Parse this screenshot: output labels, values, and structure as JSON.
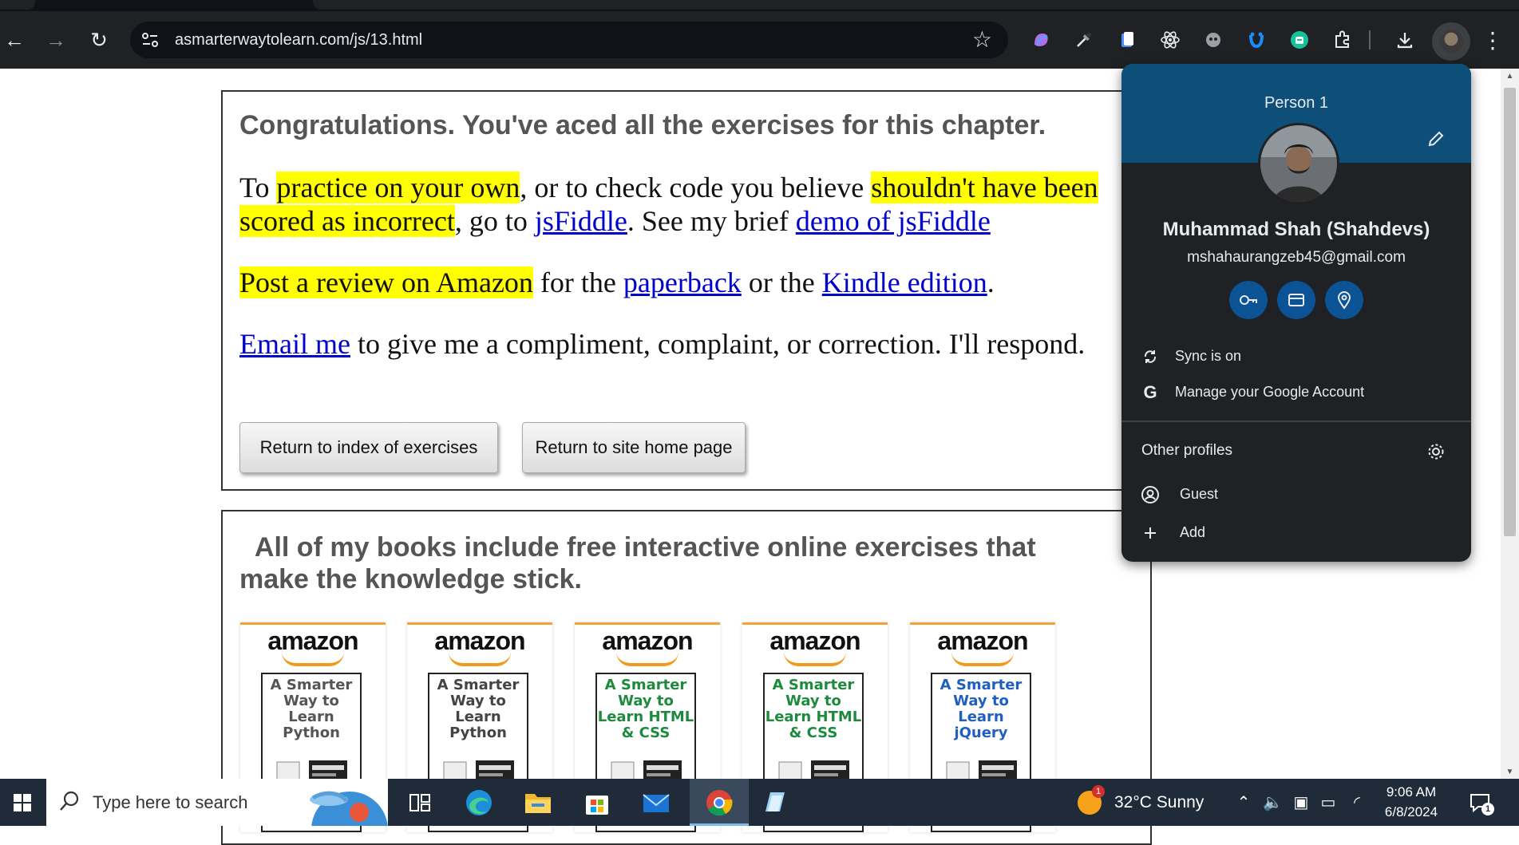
{
  "browser": {
    "url": "asmarterwaytolearn.com/js/13.html",
    "nav_back": "←",
    "nav_forward": "→",
    "nav_reload": "↻",
    "bookmark_star": "☆",
    "menu": "⋮",
    "extensions": [
      "copilot-icon",
      "eyedropper-icon",
      "docs-icon",
      "react-icon",
      "ghost-icon",
      "tampermonkey-icon",
      "grammarly-icon",
      "puzzle-icon"
    ]
  },
  "page": {
    "congrats": "Congratulations. You've aced all the exercises for this chapter.",
    "p1": {
      "t1": "To ",
      "h1": "practice on your own",
      "t2": ", or to check code you believe ",
      "h2": "shouldn't have been scored as incorrect",
      "t3": ", go to ",
      "l1": "jsFiddle",
      "t4": ". See my brief ",
      "l2": "demo of jsFiddle"
    },
    "p2": {
      "h1": "Post a review on Amazon",
      "t1": " for the ",
      "l1": "paperback",
      "t2": " or the ",
      "l2": "Kindle edition",
      "t3": "."
    },
    "p3": {
      "l1": "Email me",
      "t1": " to give me a compliment, complaint, or correction. I'll respond."
    },
    "buttons": {
      "index": "Return to index of exercises",
      "home": "Return to site home page"
    },
    "books_heading": "All of my books include free interactive online exercises that make the knowledge stick.",
    "books": [
      {
        "brand": "amazon",
        "title": "A Smarter Way to Learn Python",
        "color": "#555555"
      },
      {
        "brand": "amazon",
        "title": "A Smarter Way to Learn Python",
        "color": "#444444"
      },
      {
        "brand": "amazon",
        "title": "A Smarter Way to Learn HTML & CSS",
        "color": "#1e8a3e"
      },
      {
        "brand": "amazon",
        "title": "A Smarter Way to Learn HTML & CSS",
        "color": "#1e8a3e"
      },
      {
        "brand": "amazon",
        "title": "A Smarter Way to Learn jQuery",
        "color": "#1f5fbf"
      }
    ]
  },
  "profile_menu": {
    "person_label": "Person 1",
    "full_name": "Muhammad Shah (Shahdevs)",
    "email": "mshahaurangzeb45@gmail.com",
    "quick_actions": [
      "key-icon",
      "card-icon",
      "location-icon"
    ],
    "sync": "Sync is on",
    "manage": "Manage your Google Account",
    "other_profiles": "Other profiles",
    "guest": "Guest",
    "add": "Add"
  },
  "taskbar": {
    "search_placeholder": "Type here to search",
    "weather_temp": "32°C  Sunny",
    "weather_badge": "1",
    "time": "9:06 AM",
    "date": "6/8/2024",
    "notif_count": "1"
  }
}
